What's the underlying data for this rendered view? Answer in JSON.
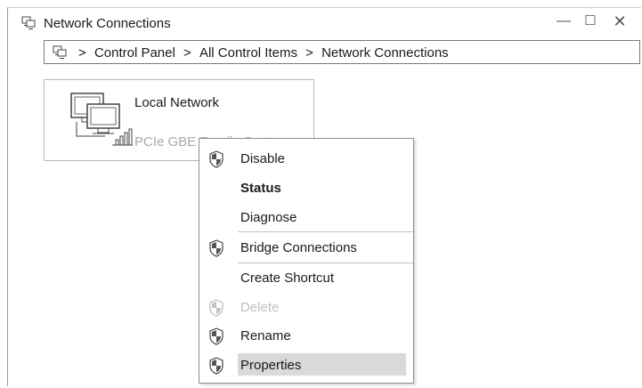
{
  "window": {
    "title": "Network Connections",
    "controls": {
      "minimize": "—",
      "maximize": "☐",
      "close": "✕"
    }
  },
  "address": {
    "crumbs": [
      "Control Panel",
      "All Control Items",
      "Network Connections"
    ],
    "separator": ">"
  },
  "connection": {
    "name": "Local Network",
    "device": "PCIe GBE Family Contr..."
  },
  "menu": {
    "items": [
      {
        "label": "Disable",
        "shield": true
      },
      {
        "label": "Status",
        "bold": true
      },
      {
        "label": "Diagnose"
      },
      {
        "label": "Bridge Connections",
        "shield": true
      },
      {
        "label": "Create Shortcut"
      },
      {
        "label": "Delete",
        "shield": true,
        "disabled": true
      },
      {
        "label": "Rename",
        "shield": true
      },
      {
        "label": "Properties",
        "shield": true,
        "highlighted": true
      }
    ]
  }
}
